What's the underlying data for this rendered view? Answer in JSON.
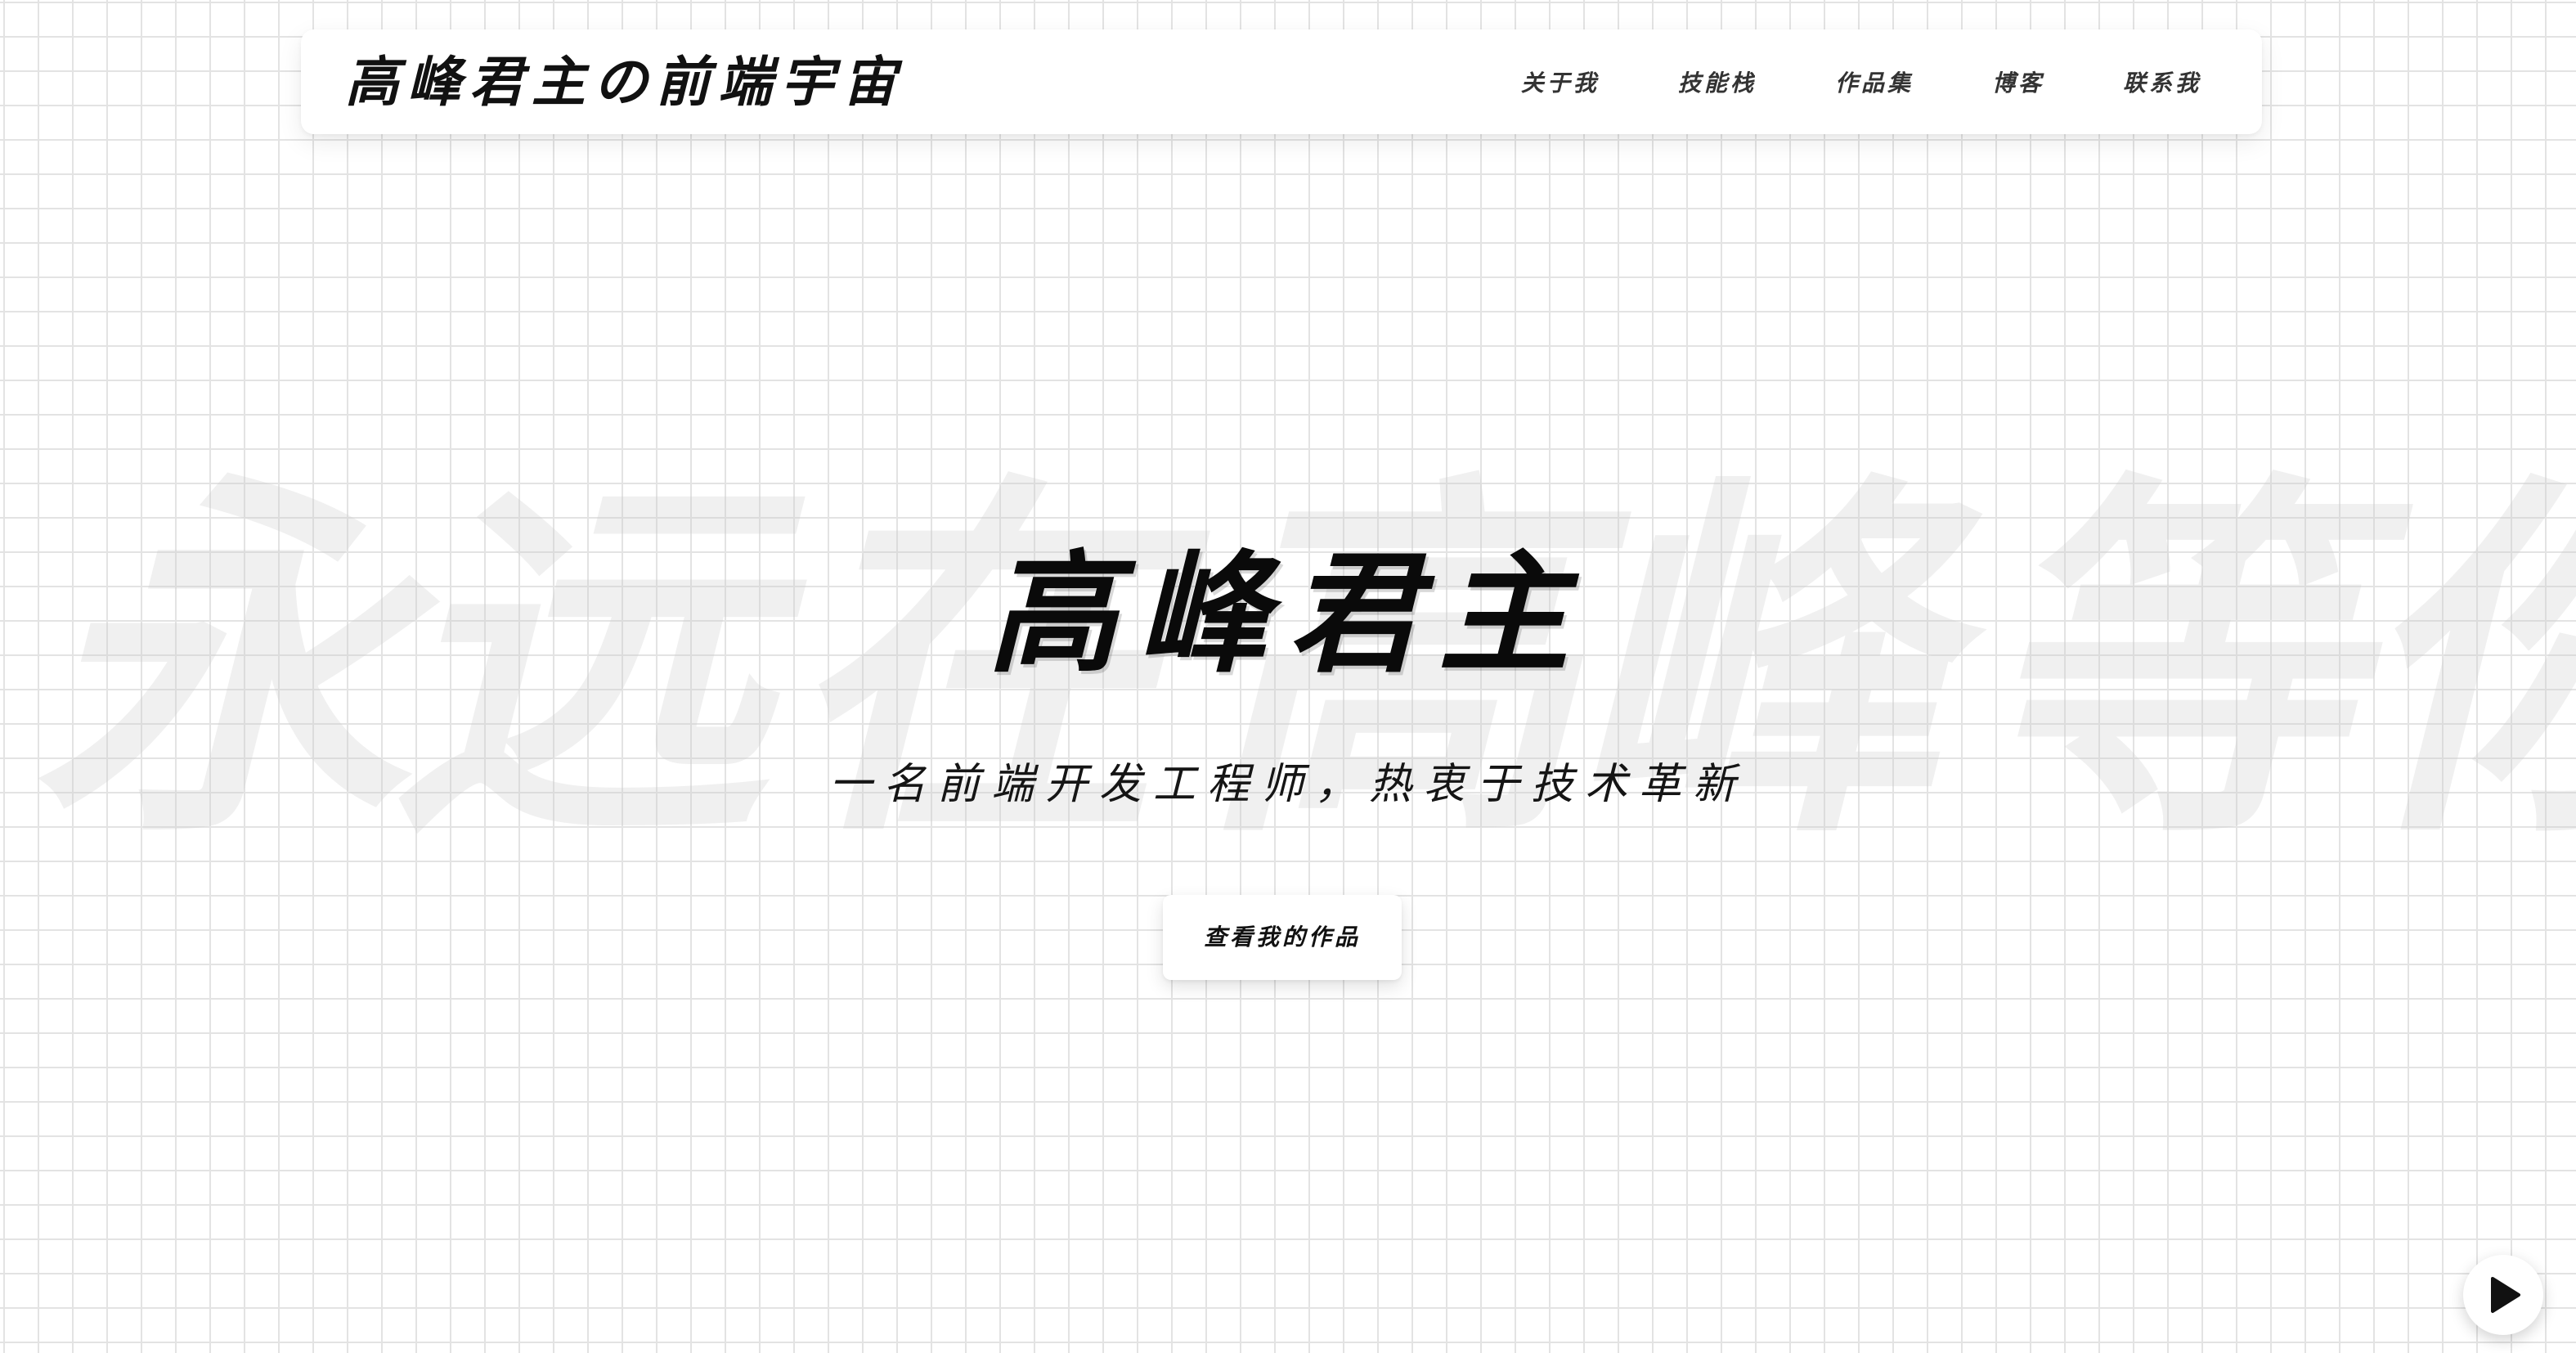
{
  "header": {
    "logo": "高峰君主の前端宇宙",
    "nav": [
      {
        "label": "关于我"
      },
      {
        "label": "技能栈"
      },
      {
        "label": "作品集"
      },
      {
        "label": "博客"
      },
      {
        "label": "联系我"
      }
    ]
  },
  "watermark": {
    "chars": [
      "永",
      "远",
      "在",
      "高",
      "峰",
      "等",
      "你"
    ]
  },
  "hero": {
    "title": "高峰君主",
    "subtitle": "一名前端开发工程师，热衷于技术革新",
    "cta_label": "查看我的作品"
  },
  "floating": {
    "play_icon": "play-icon"
  },
  "colors": {
    "grid_line": "#e3e3e3",
    "text": "#111111",
    "card_bg": "#ffffff"
  }
}
